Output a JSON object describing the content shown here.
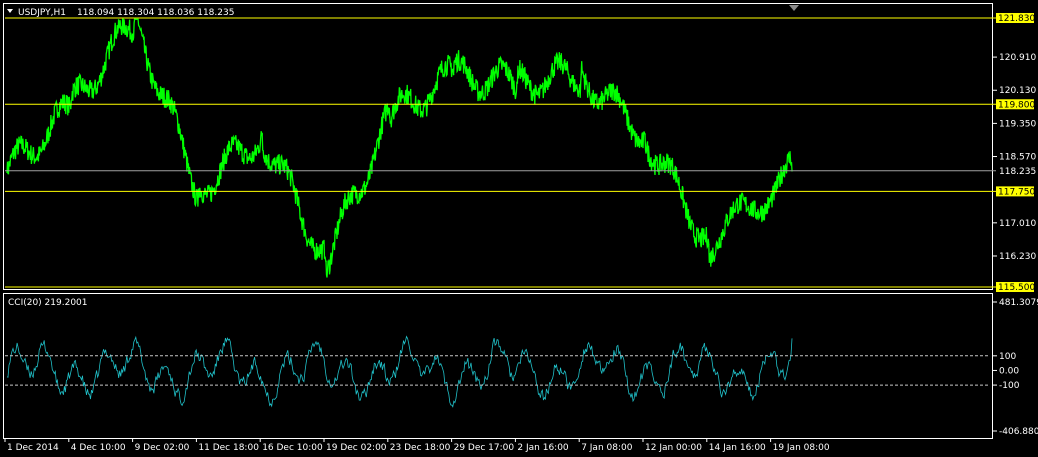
{
  "window": {
    "symbol_title": "USDJPY,H1",
    "ohlc": "118.094 118.304 118.036 118.235",
    "cci_title": "CCI(20) 219.2001"
  },
  "colors": {
    "price_line": "#00ff00",
    "cci_line": "#20c0c8",
    "hline": "#ffff00",
    "current_line": "#a0a0a0",
    "axis": "#ffffff",
    "hlabel_bg": "#ffff00"
  },
  "chart_data": [
    {
      "type": "line",
      "title": "USDJPY,H1",
      "series": [
        {
          "name": "USDJPY,H1"
        }
      ],
      "ylim": [
        115.5,
        121.83
      ],
      "yticks": [
        "120.910",
        "120.130",
        "119.350",
        "118.570",
        "117.010",
        "116.230"
      ],
      "hlines": [
        {
          "value": 121.83,
          "label": "121.830"
        },
        {
          "value": 119.8,
          "label": "119.800"
        },
        {
          "value": 117.75,
          "label": "117.750"
        },
        {
          "value": 115.5,
          "label": "115.500"
        }
      ],
      "current": {
        "value": 118.235,
        "label": "118.235"
      },
      "x": [
        "1 Dec 2014",
        "4 Dec 10:00",
        "9 Dec 02:00",
        "11 Dec 18:00",
        "16 Dec 10:00",
        "19 Dec 02:00",
        "23 Dec 18:00",
        "29 Dec 17:00",
        "2 Jan 16:00",
        "7 Jan 08:00",
        "12 Jan 00:00",
        "14 Jan 16:00",
        "19 Jan 08:00"
      ],
      "y": [
        118.2,
        119.7,
        121.8,
        117.8,
        119.1,
        116.1,
        119.5,
        120.5,
        120.3,
        120.5,
        119.1,
        116.5,
        118.235
      ],
      "grid": false
    },
    {
      "type": "line",
      "title": "CCI(20) 219.2001",
      "series": [
        {
          "name": "CCI(20)"
        }
      ],
      "ylim": [
        -406.8805,
        481.3079
      ],
      "yticks": [
        "481.3079",
        "100",
        "0.00",
        "-100",
        "-406.8805"
      ],
      "levels": [
        100,
        -100
      ],
      "last": 219.2001,
      "grid": false
    }
  ],
  "xaxis": {
    "labels": [
      "1 Dec 2014",
      "4 Dec 10:00",
      "9 Dec 02:00",
      "11 Dec 18:00",
      "16 Dec 10:00",
      "19 Dec 02:00",
      "23 Dec 18:00",
      "29 Dec 17:00",
      "2 Jan 16:00",
      "7 Jan 08:00",
      "12 Jan 00:00",
      "14 Jan 16:00",
      "19 Jan 08:00"
    ]
  }
}
